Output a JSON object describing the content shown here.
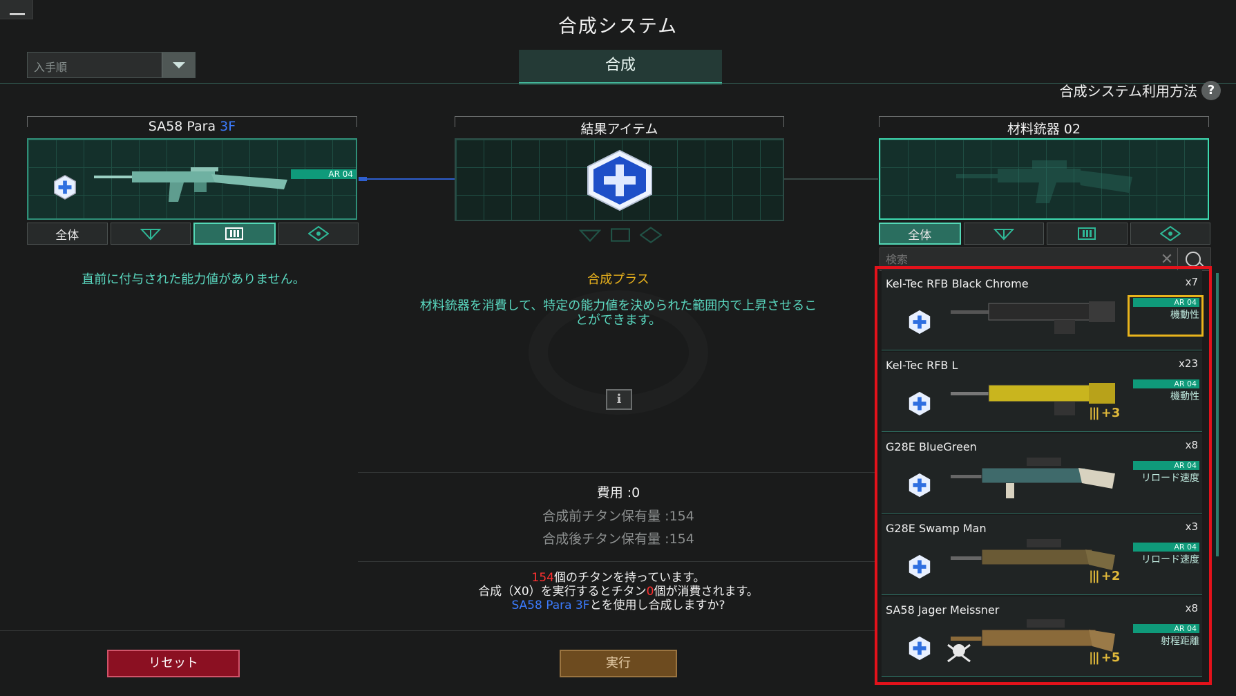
{
  "title": "合成システム",
  "sort": {
    "value": "入手順"
  },
  "tab": {
    "label": "合成"
  },
  "help": {
    "label": "合成システム利用方法",
    "icon": "?"
  },
  "slots": {
    "base": {
      "name": "SA58 Para",
      "suffix": "3F",
      "tag": "AR 04"
    },
    "result": {
      "name": "結果アイテム"
    },
    "material": {
      "name": "材料銃器 02"
    }
  },
  "filters": {
    "all_label": "全体"
  },
  "left_message": "直前に付与された能力値がありません。",
  "synth_plus": {
    "title": "合成プラス",
    "desc_line1": "材料銃器を消費して、特定の能力値を決められた範囲内で上昇させるこ",
    "desc_line2": "とができます。"
  },
  "info_icon": "i",
  "cost": {
    "label": "費用 :0",
    "titan_before": "合成前チタン保有量 :154",
    "titan_after": "合成後チタン保有量 :154"
  },
  "confirm": {
    "l1_count": "154",
    "l1_text": "個のチタンを持っています。",
    "l2_a": "合成（X0）を実行するとチタン",
    "l2_num": "0",
    "l2_b": "個が消費されます。",
    "l3_weapon": "SA58 Para 3F",
    "l3_text": "とを使用し合成しますか?"
  },
  "buttons": {
    "reset": "リセット",
    "execute": "実行"
  },
  "search": {
    "placeholder": "検索"
  },
  "weapons": [
    {
      "name": "Kel-Tec RFB Black Chrome",
      "qty": "x7",
      "tag": "AR 04",
      "stat": "機動性",
      "bonus": ""
    },
    {
      "name": "Kel-Tec RFB L",
      "qty": "x23",
      "tag": "AR 04",
      "stat": "機動性",
      "bonus": "+3"
    },
    {
      "name": "G28E BlueGreen",
      "qty": "x8",
      "tag": "AR 04",
      "stat": "リロード速度",
      "bonus": ""
    },
    {
      "name": "G28E Swamp Man",
      "qty": "x3",
      "tag": "AR 04",
      "stat": "リロード速度",
      "bonus": "+2"
    },
    {
      "name": "SA58 Jager Meissner",
      "qty": "x8",
      "tag": "AR 04",
      "stat": "射程距離",
      "bonus": "+5"
    }
  ],
  "colors": {
    "accent": "#47c9a9",
    "highlight_list": "#e3121b",
    "highlight_item": "#e8b41c",
    "reset": "#8b1022",
    "execute": "#6d4b1f"
  }
}
